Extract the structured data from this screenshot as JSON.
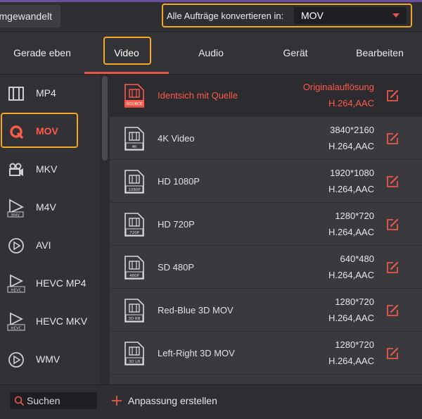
{
  "topbar": {
    "converted_tab": "Umgewandelt",
    "convert_all_label": "Alle Aufträge konvertieren in:",
    "convert_all_value": "MOV"
  },
  "tabs": [
    {
      "label": "Gerade eben"
    },
    {
      "label": "Video"
    },
    {
      "label": "Audio"
    },
    {
      "label": "Gerät"
    },
    {
      "label": "Bearbeiten"
    }
  ],
  "active_tab": "Video",
  "sidebar": {
    "items": [
      {
        "label": "MP4",
        "icon": "film-strip-icon"
      },
      {
        "label": "MOV",
        "icon": "quicktime-icon"
      },
      {
        "label": "MKV",
        "icon": "camera-icon"
      },
      {
        "label": "M4V",
        "icon": "m4v-play-icon"
      },
      {
        "label": "AVI",
        "icon": "play-circle-icon"
      },
      {
        "label": "HEVC MP4",
        "icon": "hevc-icon"
      },
      {
        "label": "HEVC MKV",
        "icon": "hevc-icon"
      },
      {
        "label": "WMV",
        "icon": "play-circle-icon"
      }
    ],
    "active": "MOV"
  },
  "presets": [
    {
      "name": "Identsich mit Quelle",
      "badge": "SOURCE",
      "resolution": "Originalauflösung",
      "codec": "H.264,AAC",
      "selected": true
    },
    {
      "name": "4K Video",
      "badge": "4K",
      "resolution": "3840*2160",
      "codec": "H.264,AAC"
    },
    {
      "name": "HD 1080P",
      "badge": "1080P",
      "resolution": "1920*1080",
      "codec": "H.264,AAC"
    },
    {
      "name": "HD 720P",
      "badge": "720P",
      "resolution": "1280*720",
      "codec": "H.264,AAC"
    },
    {
      "name": "SD 480P",
      "badge": "480P",
      "resolution": "640*480",
      "codec": "H.264,AAC"
    },
    {
      "name": "Red-Blue 3D MOV",
      "badge": "3D RB",
      "resolution": "1280*720",
      "codec": "H.264,AAC"
    },
    {
      "name": "Left-Right 3D MOV",
      "badge": "3D LR",
      "resolution": "1280*720",
      "codec": "H.264,AAC"
    }
  ],
  "bottom": {
    "search_placeholder": "Suchen",
    "create_label": "Anpassung erstellen"
  },
  "colors": {
    "accent": "#ff5a4a",
    "highlight": "#f5a623",
    "background": "#2b2a2e"
  }
}
